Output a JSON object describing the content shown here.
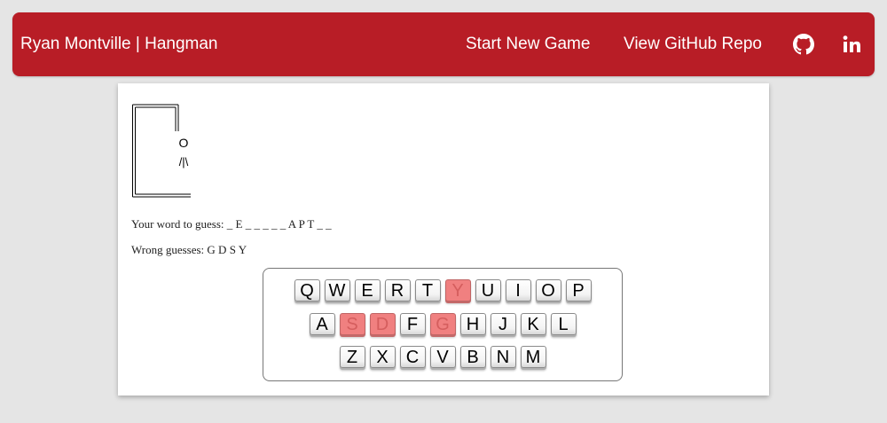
{
  "navbar": {
    "brand": "Ryan Montville | Hangman",
    "start_new_game": "Start New Game",
    "view_repo": "View GitHub Repo",
    "icons": [
      "github-icon",
      "linkedin-icon"
    ],
    "color": "#b81d26"
  },
  "hangman": {
    "head": "O",
    "body": "/|\\"
  },
  "game": {
    "word_label": "Your word to guess:",
    "word_display": "_ E _ _ _ _ _ A P T _ _",
    "wrong_label": "Wrong guesses:",
    "wrong_letters": "G D S Y"
  },
  "keyboard": {
    "row1": [
      {
        "letter": "Q",
        "used": false
      },
      {
        "letter": "W",
        "used": false
      },
      {
        "letter": "E",
        "used": false
      },
      {
        "letter": "R",
        "used": false
      },
      {
        "letter": "T",
        "used": false
      },
      {
        "letter": "Y",
        "used": true
      },
      {
        "letter": "U",
        "used": false
      },
      {
        "letter": "I",
        "used": false
      },
      {
        "letter": "O",
        "used": false
      },
      {
        "letter": "P",
        "used": false
      }
    ],
    "row2": [
      {
        "letter": "A",
        "used": false
      },
      {
        "letter": "S",
        "used": true
      },
      {
        "letter": "D",
        "used": true
      },
      {
        "letter": "F",
        "used": false
      },
      {
        "letter": "G",
        "used": true
      },
      {
        "letter": "H",
        "used": false
      },
      {
        "letter": "J",
        "used": false
      },
      {
        "letter": "K",
        "used": false
      },
      {
        "letter": "L",
        "used": false
      }
    ],
    "row3": [
      {
        "letter": "Z",
        "used": false
      },
      {
        "letter": "X",
        "used": false
      },
      {
        "letter": "C",
        "used": false
      },
      {
        "letter": "V",
        "used": false
      },
      {
        "letter": "B",
        "used": false
      },
      {
        "letter": "N",
        "used": false
      },
      {
        "letter": "M",
        "used": false
      }
    ],
    "used_color": "#f08080"
  }
}
